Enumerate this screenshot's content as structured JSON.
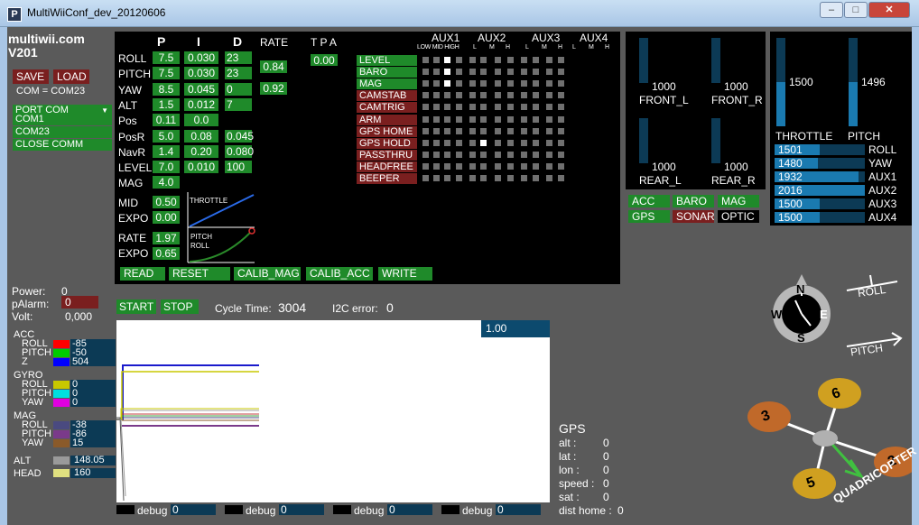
{
  "window": {
    "title": "MultiWiiConf_dev_20120606"
  },
  "header": {
    "app": "multiwii.com",
    "version": "V201",
    "save": "SAVE",
    "load": "LOAD",
    "com_status": "COM = COM23"
  },
  "port": {
    "title": "PORT COM",
    "items": [
      "COM1",
      "COM23",
      "CLOSE COMM"
    ]
  },
  "pid": {
    "headers": [
      "P",
      "I",
      "D",
      "RATE",
      "T P A"
    ],
    "rows": [
      {
        "name": "ROLL",
        "p": "7.5",
        "i": "0.030",
        "d": "23"
      },
      {
        "name": "PITCH",
        "p": "7.5",
        "i": "0.030",
        "d": "23"
      },
      {
        "name": "YAW",
        "p": "8.5",
        "i": "0.045",
        "d": "0"
      },
      {
        "name": "ALT",
        "p": "1.5",
        "i": "0.012",
        "d": "7"
      },
      {
        "name": "Pos",
        "p": "0.11",
        "i": "0.0",
        "d": ""
      },
      {
        "name": "PosR",
        "p": "5.0",
        "i": "0.08",
        "d": "0.045"
      },
      {
        "name": "NavR",
        "p": "1.4",
        "i": "0.20",
        "d": "0.080"
      },
      {
        "name": "LEVEL",
        "p": "7.0",
        "i": "0.010",
        "d": "100"
      },
      {
        "name": "MAG",
        "p": "4.0",
        "i": "",
        "d": ""
      }
    ],
    "rate_rp": "0.84",
    "rate_yaw": "0.92",
    "tpa": "0.00"
  },
  "throttle_curve": {
    "mid_label": "MID",
    "mid": "0.50",
    "expo_label": "EXPO",
    "expo": "0.00",
    "label": "THROTTLE"
  },
  "rc_curve": {
    "rate_label": "RATE",
    "rate": "1.97",
    "expo_label": "EXPO",
    "expo": "0.65",
    "label1": "PITCH",
    "label2": "ROLL"
  },
  "buttons": {
    "read": "READ",
    "reset": "RESET",
    "calib_mag": "CALIB_MAG",
    "calib_acc": "CALIB_ACC",
    "write": "WRITE",
    "start": "START",
    "stop": "STOP"
  },
  "aux": {
    "headers": [
      "AUX1",
      "AUX2",
      "AUX3",
      "AUX4"
    ],
    "sub1": [
      "LOW",
      "MID",
      "HIGH"
    ],
    "sub": [
      "L",
      "M",
      "H"
    ],
    "modes": [
      "LEVEL",
      "BARO",
      "MAG",
      "CAMSTAB",
      "CAMTRIG",
      "ARM",
      "GPS HOME",
      "GPS HOLD",
      "PASSTHRU",
      "HEADFREE",
      "BEEPER"
    ],
    "active_modes": [
      0,
      1,
      2
    ],
    "on": [
      [
        0,
        2
      ],
      [
        1,
        2
      ],
      [
        2,
        2
      ],
      [
        7,
        5
      ]
    ]
  },
  "motors": [
    {
      "name": "FRONT_L",
      "value": "1000"
    },
    {
      "name": "FRONT_R",
      "value": "1000"
    },
    {
      "name": "REAR_L",
      "value": "1000"
    },
    {
      "name": "REAR_R",
      "value": "1000"
    }
  ],
  "sensors": [
    {
      "name": "ACC",
      "state": "on"
    },
    {
      "name": "BARO",
      "state": "on"
    },
    {
      "name": "MAG",
      "state": "on"
    },
    {
      "name": "GPS",
      "state": "on"
    },
    {
      "name": "SONAR",
      "state": "off"
    },
    {
      "name": "OPTIC",
      "state": "dark"
    }
  ],
  "rc": {
    "throttle": {
      "name": "THROTTLE",
      "value": "1500",
      "level": 0.5
    },
    "pitch": {
      "name": "PITCH",
      "value": "1496",
      "level": 0.5
    },
    "channels": [
      {
        "name": "ROLL",
        "value": "1501",
        "level": 0.5
      },
      {
        "name": "YAW",
        "value": "1480",
        "level": 0.48
      },
      {
        "name": "AUX1",
        "value": "1932",
        "level": 0.93
      },
      {
        "name": "AUX2",
        "value": "2016",
        "level": 1.0
      },
      {
        "name": "AUX3",
        "value": "1500",
        "level": 0.5
      },
      {
        "name": "AUX4",
        "value": "1500",
        "level": 0.5
      }
    ]
  },
  "power": {
    "power_label": "Power:",
    "power": "0",
    "alarm_label": "pAlarm:",
    "alarm": "0",
    "volt_label": "Volt:",
    "volt": "0,000"
  },
  "status": {
    "cycle_label": "Cycle Time:",
    "cycle": "3004",
    "i2c_label": "I2C error:",
    "i2c": "0"
  },
  "graph": {
    "scale": "1.00"
  },
  "sensor_values": {
    "acc": {
      "label": "ACC",
      "rows": [
        {
          "name": "ROLL",
          "value": "-85",
          "color": "#ff0000"
        },
        {
          "name": "PITCH",
          "value": "-50",
          "color": "#00cc00"
        },
        {
          "name": "Z",
          "value": "504",
          "color": "#0000ff"
        }
      ]
    },
    "gyro": {
      "label": "GYRO",
      "rows": [
        {
          "name": "ROLL",
          "value": "0",
          "color": "#c8c800"
        },
        {
          "name": "PITCH",
          "value": "0",
          "color": "#00e0e0"
        },
        {
          "name": "YAW",
          "value": "0",
          "color": "#e000e0"
        }
      ]
    },
    "mag": {
      "label": "MAG",
      "rows": [
        {
          "name": "ROLL",
          "value": "-38",
          "color": "#4a4a80"
        },
        {
          "name": "PITCH",
          "value": "-86",
          "color": "#7a3a8a"
        },
        {
          "name": "YAW",
          "value": "15",
          "color": "#8a5a2a"
        }
      ]
    },
    "alt": {
      "label": "ALT",
      "value": "148.05",
      "color": "#9a9a9a"
    },
    "head": {
      "label": "HEAD",
      "value": "160",
      "color": "#e0e080"
    }
  },
  "debug": [
    {
      "label": "debug",
      "value": "0"
    },
    {
      "label": "debug",
      "value": "0"
    },
    {
      "label": "debug",
      "value": "0"
    },
    {
      "label": "debug",
      "value": "0"
    }
  ],
  "gps": {
    "title": "GPS",
    "rows": [
      {
        "name": "alt",
        "value": "0"
      },
      {
        "name": "lat",
        "value": "0"
      },
      {
        "name": "lon",
        "value": "0"
      },
      {
        "name": "speed",
        "value": "0"
      },
      {
        "name": "sat",
        "value": "0"
      },
      {
        "name": "dist home",
        "value": "0"
      }
    ]
  },
  "attitude": {
    "roll": "ROLL",
    "pitch": "PITCH",
    "compass": [
      "N",
      "E",
      "S",
      "W"
    ]
  },
  "quad": {
    "props": [
      "3",
      "6",
      "2",
      "5"
    ],
    "label": "QUADRICOPTER"
  }
}
